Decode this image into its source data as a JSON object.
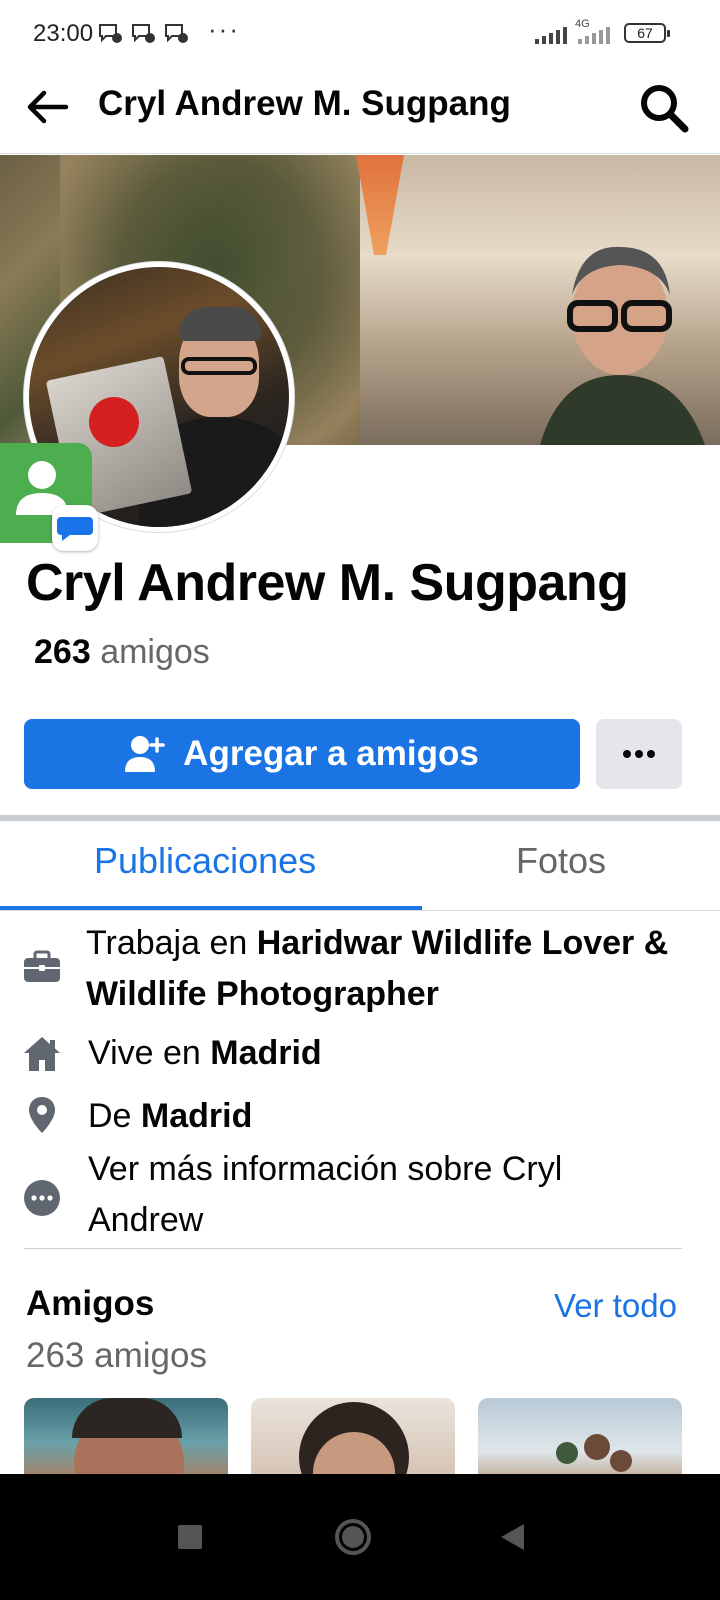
{
  "status_bar": {
    "time": "23:00",
    "more": "···",
    "network": "4G",
    "battery": "67"
  },
  "header": {
    "title": "Cryl Andrew M. Sugpang",
    "back_icon": "arrow-left-icon",
    "search_icon": "search-icon"
  },
  "profile": {
    "name": "Cryl Andrew M. Sugpang",
    "friends_count": "263",
    "friends_word": "amigos"
  },
  "actions": {
    "add_friend_label": "Agregar a amigos",
    "more_icon": "more-horizontal-icon"
  },
  "tabs": [
    {
      "label": "Publicaciones",
      "active": true
    },
    {
      "label": "Fotos",
      "active": false
    }
  ],
  "intro": {
    "work_prefix": "Trabaja en ",
    "work_place": "Haridwar Wildlife Lover & Wildlife Photographer",
    "lives_prefix": "Vive en ",
    "lives_place": "Madrid",
    "from_prefix": "De ",
    "from_place": "Madrid",
    "more_info": "Ver más información sobre Cryl Andrew"
  },
  "friends_section": {
    "title": "Amigos",
    "see_all": "Ver todo",
    "count": "263 amigos"
  },
  "colors": {
    "primary": "#1b74e4",
    "text": "#050505",
    "secondary_text": "#65676b",
    "button_gray": "#e4e6eb"
  }
}
